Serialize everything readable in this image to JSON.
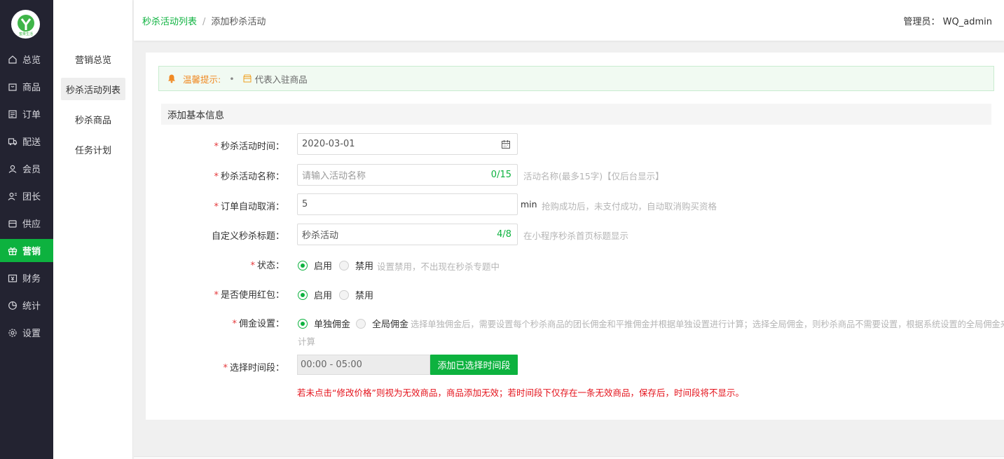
{
  "brand": {
    "logo_text": "蜜果生活",
    "accent": "#0db23f"
  },
  "nav": [
    {
      "label": "总览",
      "icon": "home-icon"
    },
    {
      "label": "商品",
      "icon": "goods-icon"
    },
    {
      "label": "订单",
      "icon": "order-icon"
    },
    {
      "label": "配送",
      "icon": "delivery-icon"
    },
    {
      "label": "会员",
      "icon": "member-icon"
    },
    {
      "label": "团长",
      "icon": "leader-icon"
    },
    {
      "label": "供应",
      "icon": "supply-icon"
    },
    {
      "label": "营销",
      "icon": "gift-icon",
      "active": true
    },
    {
      "label": "财务",
      "icon": "finance-icon"
    },
    {
      "label": "统计",
      "icon": "stats-icon"
    },
    {
      "label": "设置",
      "icon": "gear-icon"
    }
  ],
  "submenu": [
    {
      "label": "营销总览"
    },
    {
      "label": "秒杀活动列表",
      "active": true
    },
    {
      "label": "秒杀商品"
    },
    {
      "label": "任务计划"
    }
  ],
  "header": {
    "crumb_parent": "秒杀活动列表",
    "crumb_sep": "/",
    "crumb_current": "添加秒杀活动",
    "admin": "管理员： WQ_admin"
  },
  "tip": {
    "title": "温馨提示:",
    "dot": "•",
    "text": "代表入驻商品"
  },
  "section_title": "添加基本信息",
  "form": {
    "time": {
      "label": "秒杀活动时间：",
      "value": "2020-03-01"
    },
    "name": {
      "label": "秒杀活动名称：",
      "placeholder": "请输入活动名称",
      "count": "0/15",
      "hint": "活动名称(最多15字)【仅后台显示】"
    },
    "cancel": {
      "label": "订单自动取消：",
      "value": "5",
      "unit": "min",
      "hint": "抢购成功后，未支付成功，自动取消购买资格"
    },
    "title": {
      "label": "自定义秒杀标题：",
      "value": "秒杀活动",
      "count": "4/8",
      "hint": "在小程序秒杀首页标题显示"
    },
    "status": {
      "label": "状态：",
      "on": "启用",
      "off": "禁用",
      "hint": "设置禁用，不出现在秒杀专题中"
    },
    "redpack": {
      "label": "是否使用红包：",
      "on": "启用",
      "off": "禁用"
    },
    "commission": {
      "label": "佣金设置：",
      "opt1": "单独佣金",
      "opt2": "全局佣金",
      "hint1": "选择单独佣金后，需要设置每个秒杀商品的团长佣金和平推佣金并根据单独设置进行计算；选择全局佣金，则秒杀商品不需要设置，根据系统设置的全局佣金来",
      "hint2": "计算"
    },
    "slot": {
      "label": "选择时间段：",
      "value": "00:00 - 05:00",
      "button": "添加已选择时间段"
    },
    "warning": "若未点击“修改价格”则视为无效商品，商品添加无效；若时间段下仅存在一条无效商品，保存后，时间段将不显示。"
  }
}
